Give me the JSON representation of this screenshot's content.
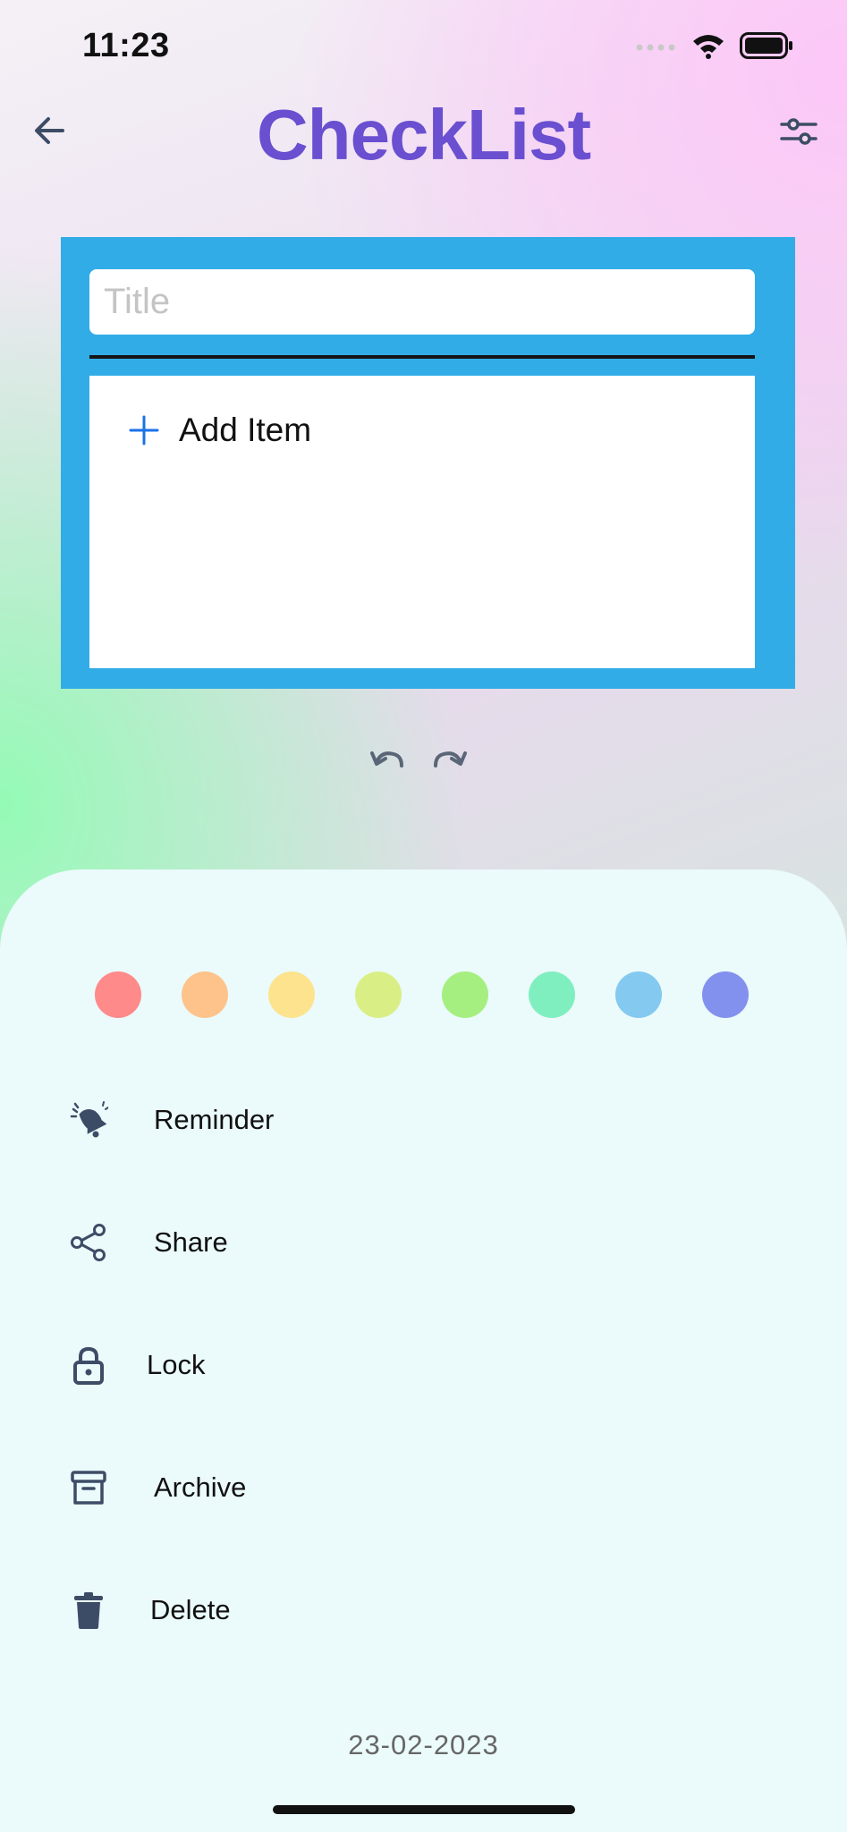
{
  "status_bar": {
    "time": "11:23"
  },
  "header": {
    "title": "CheckList"
  },
  "editor": {
    "title_placeholder": "Title",
    "title_value": "",
    "add_item_label": "Add Item"
  },
  "colors": {
    "card_background": "#32ace6",
    "title": "#6a4fd0",
    "accent_plus": "#1a73e8",
    "palette": [
      "#fe8a8a",
      "#fec38b",
      "#fde38d",
      "#d9ef86",
      "#a5ef81",
      "#80efc0",
      "#83c9f0",
      "#8391ee"
    ]
  },
  "menu": {
    "items": [
      {
        "label": "Reminder",
        "icon": "bell-icon"
      },
      {
        "label": "Share",
        "icon": "share-icon"
      },
      {
        "label": "Lock",
        "icon": "lock-icon"
      },
      {
        "label": "Archive",
        "icon": "archive-icon"
      },
      {
        "label": "Delete",
        "icon": "trash-icon"
      }
    ]
  },
  "footer": {
    "date": "23-02-2023"
  }
}
